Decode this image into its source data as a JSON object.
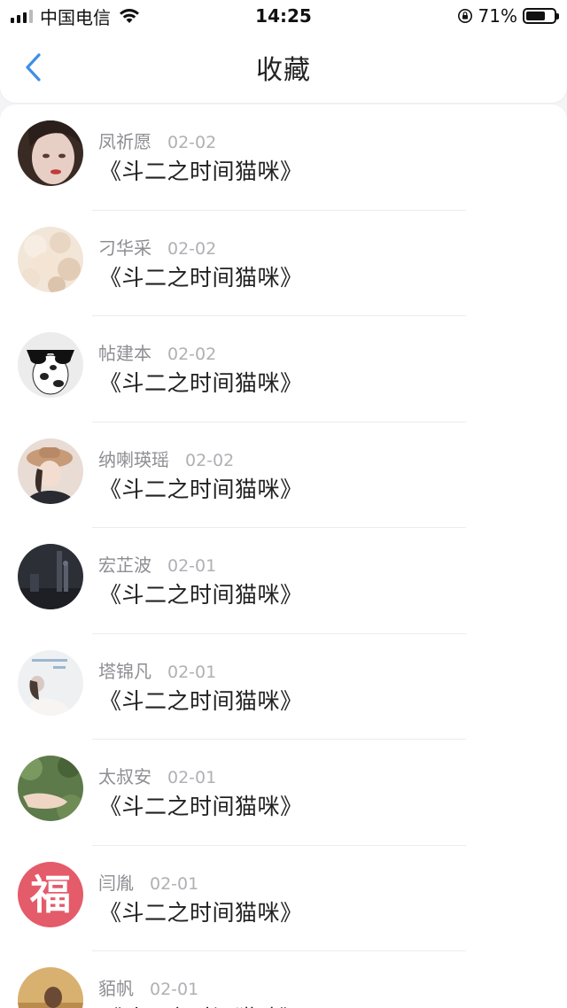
{
  "status_bar": {
    "carrier": "中国电信",
    "time": "14:25",
    "battery_percent": "71%",
    "battery_level": 0.71,
    "icons": [
      "signal-icon",
      "wifi-icon",
      "rotation-lock-icon",
      "battery-icon"
    ]
  },
  "nav": {
    "back_icon": "chevron-left-icon",
    "title": "收藏"
  },
  "colors": {
    "accent": "#3d8fe6",
    "name_gray": "#8e8e93",
    "date_gray": "#b0b0b5",
    "title_text": "#222222"
  },
  "items": [
    {
      "name": "凤祈愿",
      "date": "02-02",
      "title": "《斗二之时间猫咪》",
      "avatar": "girl-portrait-avatar"
    },
    {
      "name": "刁华采",
      "date": "02-02",
      "title": "《斗二之时间猫咪》",
      "avatar": "flowers-avatar"
    },
    {
      "name": "帖建本",
      "date": "02-02",
      "title": "《斗二之时间猫咪》",
      "avatar": "cow-sunglasses-avatar"
    },
    {
      "name": "纳喇瑛瑶",
      "date": "02-02",
      "title": "《斗二之时间猫咪》",
      "avatar": "girl-hat-avatar"
    },
    {
      "name": "宏芷波",
      "date": "02-01",
      "title": "《斗二之时间猫咪》",
      "avatar": "dark-street-avatar"
    },
    {
      "name": "塔锦凡",
      "date": "02-01",
      "title": "《斗二之时间猫咪》",
      "avatar": "reading-girl-avatar"
    },
    {
      "name": "太叔安",
      "date": "02-01",
      "title": "《斗二之时间猫咪》",
      "avatar": "hand-greenery-avatar"
    },
    {
      "name": "闫胤",
      "date": "02-01",
      "title": "《斗二之时间猫咪》",
      "avatar": "fu-character-avatar",
      "avatar_text": "福"
    },
    {
      "name": "貊帆",
      "date": "02-01",
      "title": "《斗二之时间猫咪》",
      "avatar": "sunset-girl-avatar"
    }
  ]
}
